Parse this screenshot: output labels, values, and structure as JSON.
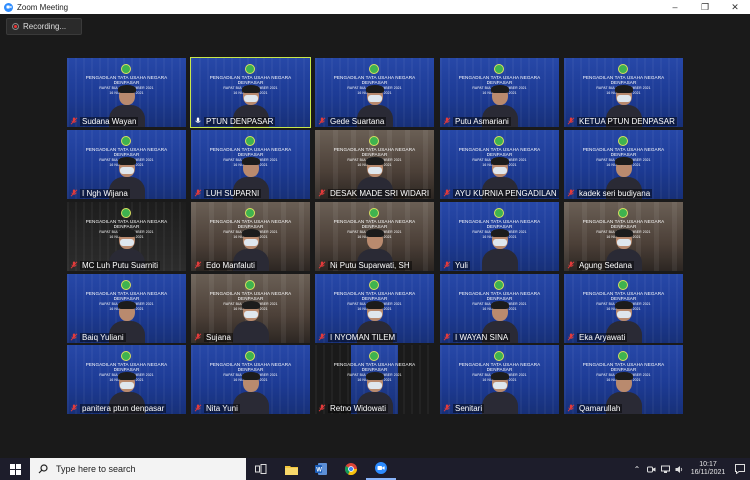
{
  "window": {
    "title": "Zoom Meeting",
    "minimize": "–",
    "maximize": "❐",
    "close": "✕"
  },
  "recording": {
    "label": "Recording..."
  },
  "banner": {
    "line1": "PENGADILAN TATA USAHA NEGARA DENPASAR",
    "line2": "RAPAT BULAN NOVEMBER 2021",
    "line3": "16 NOVEMBER 2021"
  },
  "participants": [
    {
      "name": "Sudana Wayan",
      "muted": true
    },
    {
      "name": "PTUN DENPASAR",
      "muted": false,
      "active": true
    },
    {
      "name": "Gede Suartana",
      "muted": true
    },
    {
      "name": "Putu Asmariani",
      "muted": true
    },
    {
      "name": "KETUA PTUN DENPASAR",
      "muted": true
    },
    {
      "name": "I Ngh Wijana",
      "muted": true
    },
    {
      "name": "LUH SUPARNI",
      "muted": true
    },
    {
      "name": "DESAK MADE SRI WIDARI",
      "muted": true
    },
    {
      "name": "AYU KURNIA PENGADILAN",
      "muted": true
    },
    {
      "name": "kadek seri budiyana",
      "muted": true
    },
    {
      "name": "MC Luh Putu Suarniti",
      "muted": true
    },
    {
      "name": "Edo Manfaluti",
      "muted": true
    },
    {
      "name": "Ni Putu Suparwati, SH",
      "muted": true
    },
    {
      "name": "Yuli",
      "muted": true
    },
    {
      "name": "Agung Sedana",
      "muted": true
    },
    {
      "name": "Baiq Yuliani",
      "muted": true
    },
    {
      "name": "Sujana",
      "muted": true
    },
    {
      "name": "I NYOMAN TILEM",
      "muted": true
    },
    {
      "name": "I WAYAN SINA",
      "muted": true
    },
    {
      "name": "Eka Aryawati",
      "muted": true
    },
    {
      "name": "panitera ptun denpasar",
      "muted": true
    },
    {
      "name": "Nita Yuni",
      "muted": true
    },
    {
      "name": "Retno Widowati",
      "muted": true
    },
    {
      "name": "Senitari",
      "muted": true
    },
    {
      "name": "Qamarullah",
      "muted": true
    }
  ],
  "taskbar": {
    "search_placeholder": "Type here to search",
    "time": "10:17",
    "date": "16/11/2021",
    "icons": [
      "windows-start-icon",
      "search-icon",
      "task-view-icon",
      "file-explorer-icon",
      "word-icon",
      "chrome-icon",
      "zoom-icon"
    ]
  },
  "colors": {
    "active_speaker": "#c8e84a",
    "tile_blue": "#1e3a8a",
    "muted_mic": "#e33b3b",
    "zoom_accent": "#2d8cff"
  }
}
